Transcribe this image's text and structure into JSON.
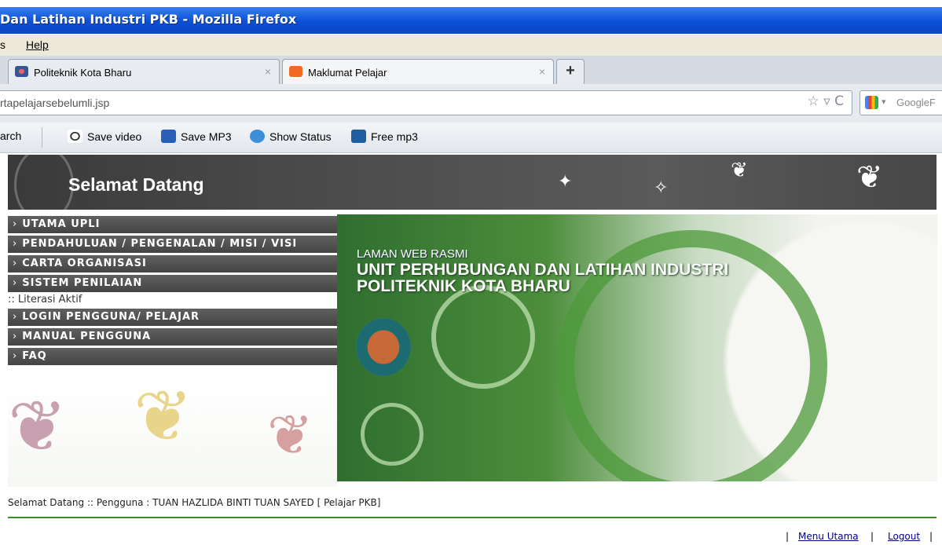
{
  "window": {
    "title": "Dan Latihan Industri PKB - Mozilla Firefox"
  },
  "menubar": {
    "partial": "s",
    "help": "Help"
  },
  "tabs": [
    {
      "label": "Politeknik Kota Bharu",
      "close": "×"
    },
    {
      "label": "Maklumat Pelajar",
      "close": "×"
    }
  ],
  "newtab": "+",
  "urlbar": {
    "value": "rtapelajarsebelumli.jsp",
    "controls": "☆ ▿ C"
  },
  "searchbox": {
    "placeholder": "GoogleF",
    "dropdown": "▾"
  },
  "toolbar": {
    "search": "arch",
    "items": [
      "Save video",
      "Save MP3",
      "Show Status",
      "Free mp3"
    ]
  },
  "banner": {
    "title": "Selamat Datang"
  },
  "menu": {
    "arrow": "›",
    "items": [
      "UTAMA UPLI",
      "PENDAHULUAN / PENGENALAN / MISI / VISI",
      "CARTA ORGANISASI",
      "SISTEM PENILAIAN",
      "LOGIN PENGGUNA/ PELAJAR",
      "MANUAL PENGGUNA",
      "FAQ"
    ],
    "sub_item": ":: Literasi Aktif"
  },
  "hero": {
    "small": "LAMAN WEB RASMI",
    "line1": "UNIT PERHUBUNGAN DAN LATIHAN INDUSTRI",
    "line2": "POLITEKNIK KOTA BHARU"
  },
  "footer": {
    "welcome": "Selamat Datang :: Pengguna : TUAN HAZLIDA BINTI TUAN SAYED [ Pelajar PKB]",
    "sep": "|",
    "menu_utama": "Menu Utama",
    "logout": "Logout"
  },
  "colors": {
    "titlebar": "#0a4fd6",
    "accent_green": "#3c8a2c",
    "menu_bg": "#505050"
  }
}
